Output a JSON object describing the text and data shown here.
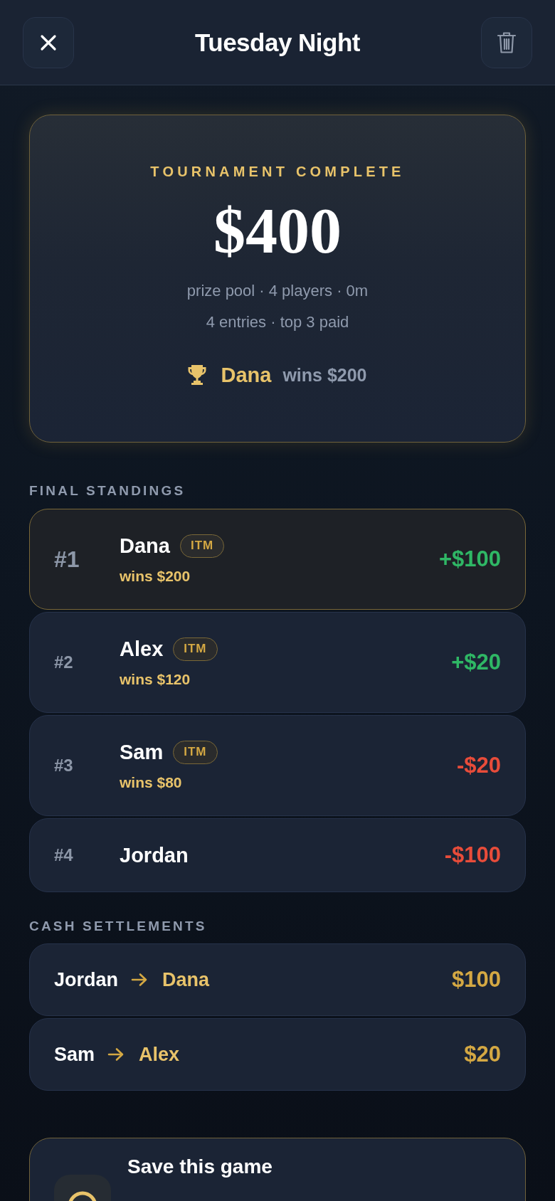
{
  "header": {
    "title": "Tuesday Night"
  },
  "summary": {
    "status": "TOURNAMENT COMPLETE",
    "prize_pool": "$400",
    "details": [
      "prize pool · 4 players · 0m",
      "4 entries · top 3 paid"
    ],
    "winner": {
      "name": "Dana",
      "prize": "wins $200"
    }
  },
  "standings": {
    "heading": "FINAL STANDINGS",
    "rows": [
      {
        "rank": "#1",
        "name": "Dana",
        "badge": "ITM",
        "winnings": "wins $200",
        "net": {
          "text": "+$100",
          "color": "#2fb765"
        },
        "highlighted": true
      },
      {
        "rank": "#2",
        "name": "Alex",
        "badge": "ITM",
        "winnings": "wins $120",
        "net": {
          "text": "+$20",
          "color": "#2fb765"
        },
        "highlighted": false
      },
      {
        "rank": "#3",
        "name": "Sam",
        "badge": "ITM",
        "winnings": "wins $80",
        "net": {
          "text": "-$20",
          "color": "#e84c3a"
        },
        "highlighted": false
      },
      {
        "rank": "#4",
        "name": "Jordan",
        "net": {
          "text": "-$100",
          "color": "#e84c3a"
        },
        "highlighted": false
      }
    ]
  },
  "settlements": {
    "heading": "CASH SETTLEMENTS",
    "rows": [
      {
        "from": "Jordan",
        "to": "Dana",
        "amount": "$100"
      },
      {
        "from": "Sam",
        "to": "Alex",
        "amount": "$20"
      }
    ]
  },
  "save_card": {
    "title": "Save this game"
  }
}
